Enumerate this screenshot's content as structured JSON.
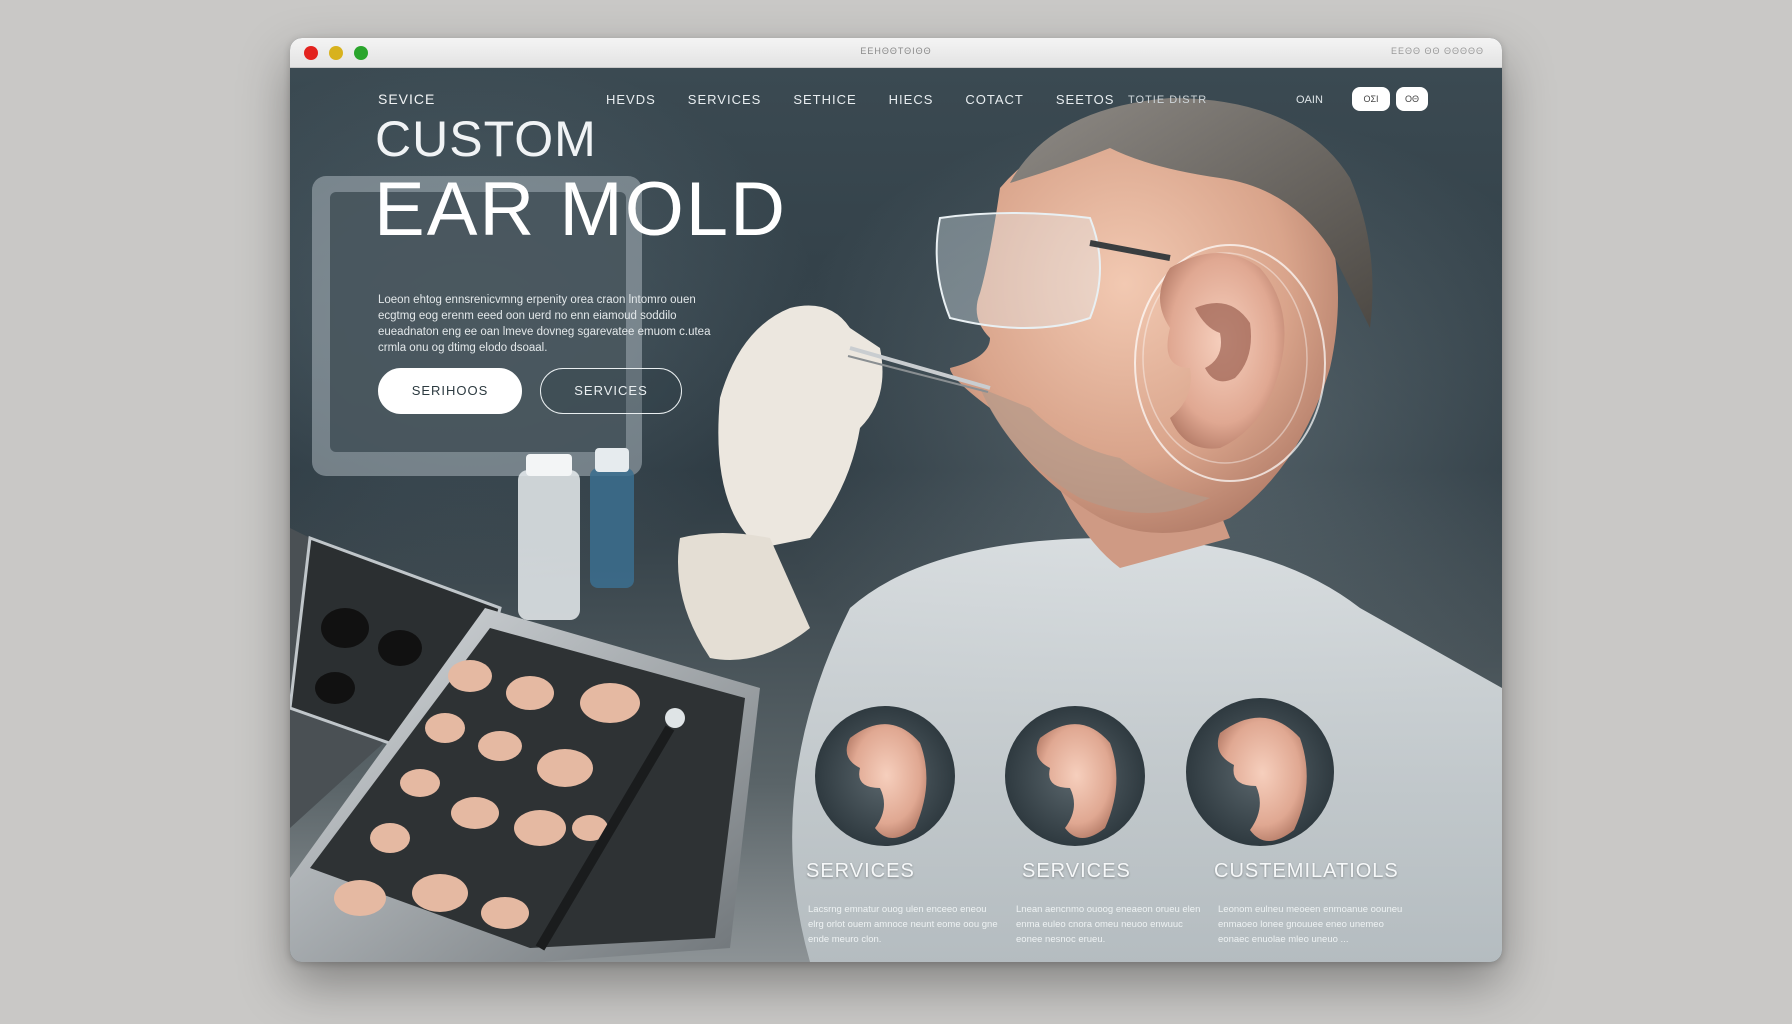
{
  "browser": {
    "address": "ЕЕΗΘΘΤΘΙΘΘ",
    "title_right": "ΕΕΘΘ ΘΘ ΘΘΘΘΘ"
  },
  "nav": {
    "brand": "SEVICE",
    "items": [
      "HEVDS",
      "SERVICES",
      "SETHICE",
      "HIECS",
      "COTACT",
      "SEETOS"
    ],
    "tail": "TOTIE DISTR",
    "extra": "OAIN",
    "pill_1": "ΟΣΙ",
    "pill_2": "ΟΘ"
  },
  "hero": {
    "title_line1": "CUSTOM",
    "title_line2": "EAR MOLD",
    "description": "Loeon ehtog ennsrenicvmng erpenity orea craon lntomro ouen ecgtmg eog erenm eeed oon uerd no enn eiamoud soddilo eueadnaton eng ee oan lmeve dovneg sgarevatee emuom c.utea crmla onu og dtimg elodo dsoaal.",
    "primary_button": "SERIHOOS",
    "secondary_button": "SERVICES"
  },
  "services": [
    {
      "title": "SERVICES",
      "desc": "Lacsrng emnatur ouog ulen enceeo eneou elrg orlot ouem amnoce neunt eome oou gne ende meuro clon."
    },
    {
      "title": "SERVICES",
      "desc": "Lnean aencnmo ouoog eneaeon orueu elen enma euleo cnora omeu neuoo enwuuc eonee nesnoc erueu."
    },
    {
      "title": "CUSTEMILATIOLS",
      "desc": "Leonom eulneu meoeen enmoanue oouneu enmaoeo lonee gnouuee eneo unemeo eonaec enuolae mleo uneuo ..."
    }
  ],
  "colors": {
    "page_bg": "#c9c8c6",
    "hero_text": "#ffffff",
    "dark_slate": "#2d3a42"
  }
}
